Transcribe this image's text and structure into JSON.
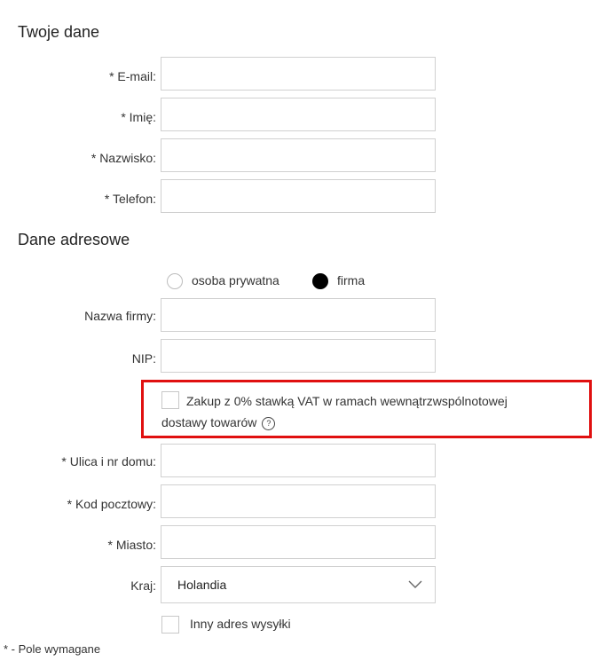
{
  "sections": {
    "personal_title": "Twoje dane",
    "address_title": "Dane adresowe"
  },
  "personal": {
    "email_label": "* E-mail:",
    "email_value": "",
    "first_name_label": "* Imię:",
    "first_name_value": "",
    "last_name_label": "* Nazwisko:",
    "last_name_value": "",
    "phone_label": "* Telefon:",
    "phone_value": ""
  },
  "customer_type": {
    "private_label": "osoba prywatna",
    "company_label": "firma",
    "selected": "firma"
  },
  "company": {
    "company_name_label": "Nazwa firmy:",
    "company_name_value": "",
    "nip_label": "NIP:",
    "nip_value": ""
  },
  "vat": {
    "checked": false,
    "text_line1": "Zakup z 0% stawką VAT w ramach wewnątrzwspólnotowej",
    "text_line2": "dostawy towarów",
    "help_icon": "question-circle-icon",
    "highlight_color": "#e01010"
  },
  "address": {
    "street_label": "* Ulica i nr domu:",
    "street_value": "",
    "postal_label": "* Kod pocztowy:",
    "postal_value": "",
    "city_label": "* Miasto:",
    "city_value": "",
    "country_label": "Kraj:",
    "country_value": "Holandia"
  },
  "shipping": {
    "other_address_label": "Inny adres wysyłki",
    "checked": false
  },
  "footnote": "* - Pole wymagane"
}
